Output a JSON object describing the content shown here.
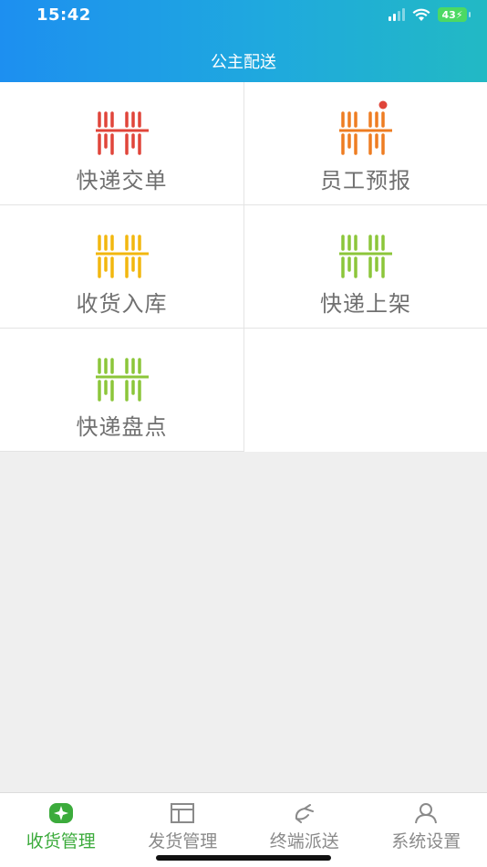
{
  "status_bar": {
    "time": "15:42",
    "battery": "43"
  },
  "header": {
    "title": "公主配送"
  },
  "menu": [
    {
      "label": "快递交单",
      "color": "#e0453a",
      "badge": false
    },
    {
      "label": "员工预报",
      "color": "#ee7d22",
      "badge": true,
      "badge_color": "#e0453a"
    },
    {
      "label": "收货入库",
      "color": "#f2b70f",
      "badge": false
    },
    {
      "label": "快递上架",
      "color": "#8cc63a",
      "badge": false
    },
    {
      "label": "快递盘点",
      "color": "#8cc63a",
      "badge": false
    }
  ],
  "tabs": [
    {
      "label": "收货管理",
      "icon": "receive-icon",
      "active": true
    },
    {
      "label": "发货管理",
      "icon": "ship-icon",
      "active": false
    },
    {
      "label": "终端派送",
      "icon": "dispatch-icon",
      "active": false
    },
    {
      "label": "系统设置",
      "icon": "user-icon",
      "active": false
    }
  ],
  "colors": {
    "active_tab": "#3cab3c",
    "inactive_tab": "#8a8a8a",
    "label_text": "#707070"
  }
}
